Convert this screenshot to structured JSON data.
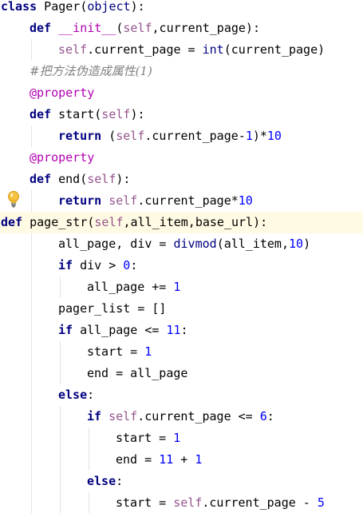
{
  "editor": {
    "lines": [
      {
        "indent": 0,
        "tokens": [
          {
            "t": "class",
            "c": "kw"
          },
          {
            "t": " Pager(",
            "c": "plain"
          },
          {
            "t": "object",
            "c": "builtin"
          },
          {
            "t": "):",
            "c": "plain"
          }
        ]
      },
      {
        "indent": 1,
        "tokens": [
          {
            "t": "def",
            "c": "kw"
          },
          {
            "t": " ",
            "c": "plain"
          },
          {
            "t": "__init__",
            "c": "magic"
          },
          {
            "t": "(",
            "c": "plain"
          },
          {
            "t": "self",
            "c": "self"
          },
          {
            "t": ",current_page):",
            "c": "plain"
          }
        ]
      },
      {
        "indent": 2,
        "tokens": [
          {
            "t": "self",
            "c": "self"
          },
          {
            "t": ".current_page = ",
            "c": "plain"
          },
          {
            "t": "int",
            "c": "builtin"
          },
          {
            "t": "(current_page)",
            "c": "plain"
          }
        ]
      },
      {
        "indent": 1,
        "tokens": [
          {
            "t": "#把方法伪造成属性(1)",
            "c": "comment"
          }
        ]
      },
      {
        "indent": 1,
        "tokens": [
          {
            "t": "@property",
            "c": "deco"
          }
        ]
      },
      {
        "indent": 1,
        "tokens": [
          {
            "t": "def",
            "c": "kw"
          },
          {
            "t": " start(",
            "c": "plain"
          },
          {
            "t": "self",
            "c": "self"
          },
          {
            "t": "):",
            "c": "plain"
          }
        ]
      },
      {
        "indent": 2,
        "tokens": [
          {
            "t": "return",
            "c": "kw"
          },
          {
            "t": " (",
            "c": "plain"
          },
          {
            "t": "self",
            "c": "self"
          },
          {
            "t": ".current_page-",
            "c": "plain"
          },
          {
            "t": "1",
            "c": "num"
          },
          {
            "t": ")*",
            "c": "plain"
          },
          {
            "t": "10",
            "c": "num"
          }
        ]
      },
      {
        "indent": 1,
        "tokens": [
          {
            "t": "@property",
            "c": "deco"
          }
        ]
      },
      {
        "indent": 1,
        "tokens": [
          {
            "t": "def",
            "c": "kw"
          },
          {
            "t": " end(",
            "c": "plain"
          },
          {
            "t": "self",
            "c": "self"
          },
          {
            "t": "):",
            "c": "plain"
          }
        ]
      },
      {
        "indent": 2,
        "tokens": [
          {
            "t": "return",
            "c": "kw"
          },
          {
            "t": " ",
            "c": "plain"
          },
          {
            "t": "self",
            "c": "self"
          },
          {
            "t": ".current_page*",
            "c": "plain"
          },
          {
            "t": "10",
            "c": "num"
          }
        ]
      },
      {
        "indent": 0,
        "caret": true,
        "tokens": [
          {
            "t": "def",
            "c": "kw"
          },
          {
            "t": " page_str(",
            "c": "plain"
          },
          {
            "t": "self",
            "c": "self"
          },
          {
            "t": ",all_item,base_url):",
            "c": "plain"
          }
        ]
      },
      {
        "indent": 2,
        "tokens": [
          {
            "t": "all_page, div = ",
            "c": "plain"
          },
          {
            "t": "divmod",
            "c": "builtin"
          },
          {
            "t": "(all_item,",
            "c": "plain"
          },
          {
            "t": "10",
            "c": "num"
          },
          {
            "t": ")",
            "c": "plain"
          }
        ]
      },
      {
        "indent": 2,
        "tokens": [
          {
            "t": "if",
            "c": "kw"
          },
          {
            "t": " div > ",
            "c": "plain"
          },
          {
            "t": "0",
            "c": "num"
          },
          {
            "t": ":",
            "c": "plain"
          }
        ]
      },
      {
        "indent": 3,
        "tokens": [
          {
            "t": "all_page += ",
            "c": "plain"
          },
          {
            "t": "1",
            "c": "num"
          }
        ]
      },
      {
        "indent": 2,
        "tokens": [
          {
            "t": "pager_list = []",
            "c": "plain"
          }
        ]
      },
      {
        "indent": 2,
        "tokens": [
          {
            "t": "if",
            "c": "kw"
          },
          {
            "t": " all_page <= ",
            "c": "plain"
          },
          {
            "t": "11",
            "c": "num"
          },
          {
            "t": ":",
            "c": "plain"
          }
        ]
      },
      {
        "indent": 3,
        "tokens": [
          {
            "t": "start = ",
            "c": "plain"
          },
          {
            "t": "1",
            "c": "num"
          }
        ]
      },
      {
        "indent": 3,
        "tokens": [
          {
            "t": "end = all_page",
            "c": "plain"
          }
        ]
      },
      {
        "indent": 2,
        "tokens": [
          {
            "t": "else",
            "c": "kw"
          },
          {
            "t": ":",
            "c": "plain"
          }
        ]
      },
      {
        "indent": 3,
        "tokens": [
          {
            "t": "if",
            "c": "kw"
          },
          {
            "t": " ",
            "c": "plain"
          },
          {
            "t": "self",
            "c": "self"
          },
          {
            "t": ".current_page <= ",
            "c": "plain"
          },
          {
            "t": "6",
            "c": "num"
          },
          {
            "t": ":",
            "c": "plain"
          }
        ]
      },
      {
        "indent": 4,
        "tokens": [
          {
            "t": "start = ",
            "c": "plain"
          },
          {
            "t": "1",
            "c": "num"
          }
        ]
      },
      {
        "indent": 4,
        "tokens": [
          {
            "t": "end = ",
            "c": "plain"
          },
          {
            "t": "11",
            "c": "num"
          },
          {
            "t": " + ",
            "c": "plain"
          },
          {
            "t": "1",
            "c": "num"
          }
        ]
      },
      {
        "indent": 3,
        "tokens": [
          {
            "t": "else",
            "c": "kw"
          },
          {
            "t": ":",
            "c": "plain"
          }
        ]
      },
      {
        "indent": 4,
        "tokens": [
          {
            "t": "start = ",
            "c": "plain"
          },
          {
            "t": "self",
            "c": "self"
          },
          {
            "t": ".current_page - ",
            "c": "plain"
          },
          {
            "t": "5",
            "c": "num"
          }
        ]
      }
    ],
    "gutter_icon": "lightbulb-icon",
    "colors": {
      "keyword": "#000080",
      "self": "#94558d",
      "number": "#0000ff",
      "decorator": "#b200b2",
      "comment": "#808080",
      "caret_row": "#fffae3",
      "indent_guide": "#e3e3e3"
    }
  }
}
